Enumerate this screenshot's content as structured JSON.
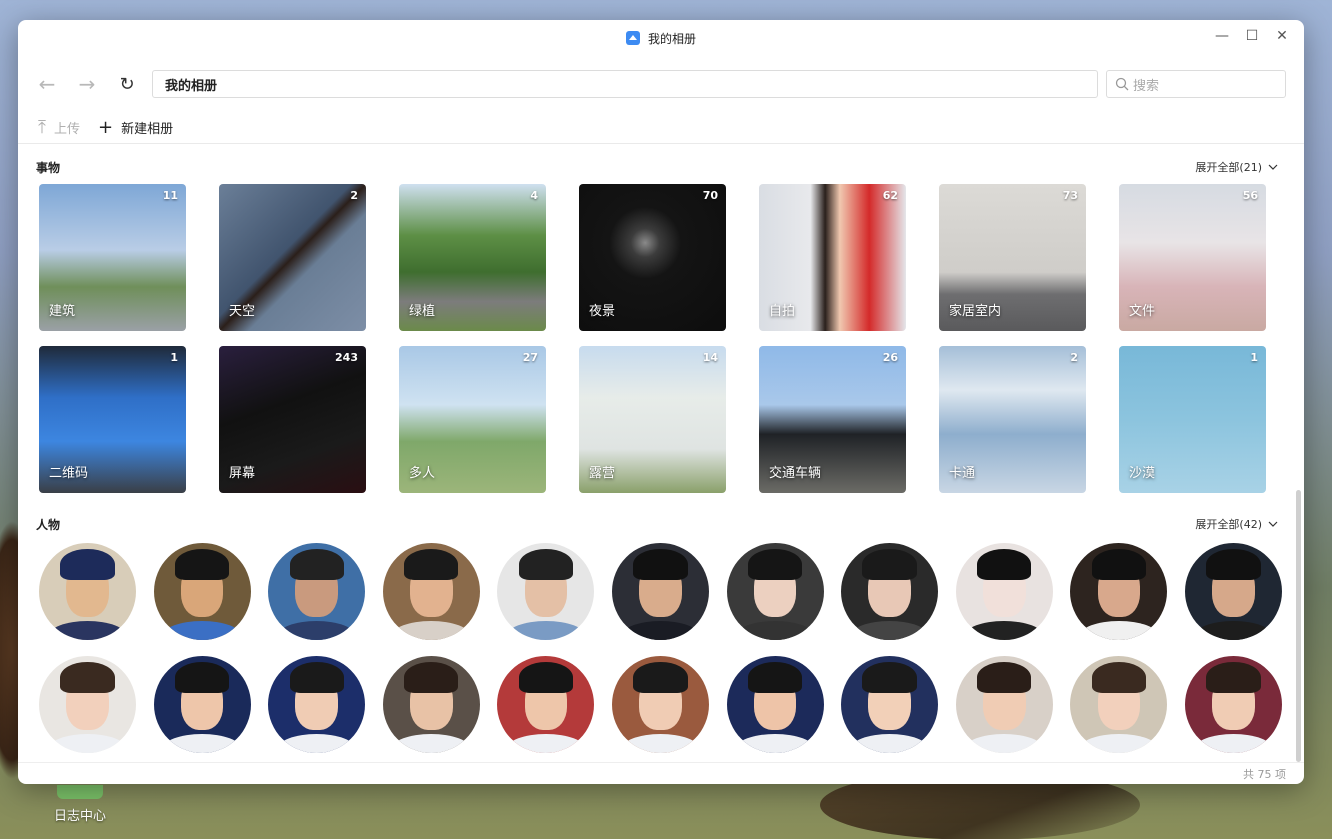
{
  "window": {
    "title": "我的相册"
  },
  "nav": {
    "path": "我的相册",
    "search_placeholder": "搜索"
  },
  "toolbar": {
    "upload_label": "上传",
    "new_album_label": "新建相册"
  },
  "things": {
    "title": "事物",
    "expand_label": "展开全部(21)",
    "tiles": [
      {
        "name": "建筑",
        "count": "11",
        "bg": "linear-gradient(180deg,#7ea7d6 0%,#b9cde6 45%,#6f8f5a 70%,#9aa0a6 100%)"
      },
      {
        "name": "天空",
        "count": "2",
        "bg": "linear-gradient(135deg,#6b7f98 0%,#41546e 45%,#2b1f1a 50%,#6a7e96 60%,#7d8ea6 100%)"
      },
      {
        "name": "绿植",
        "count": "4",
        "bg": "linear-gradient(180deg,#cfe0f0 0%,#5d8f45 35%,#3f6e2f 60%,#7c7c7c 80%,#6b8a4a 100%)"
      },
      {
        "name": "夜景",
        "count": "70",
        "bg": "radial-gradient(circle at 45% 40%,#8a8a8a 0%,#3c3c3c 12%,#141414 30%,#0d0d0d 100%)"
      },
      {
        "name": "自拍",
        "count": "62",
        "bg": "linear-gradient(90deg,#d9dde3 0%,#e8e9ec 35%,#2a201c 45%,#f0c8b0 55%,#d42a2a 75%,#e4e6ea 100%)"
      },
      {
        "name": "家居室内",
        "count": "73",
        "bg": "linear-gradient(180deg,#dcdad6 0%,#cfcdc9 60%,#6e6e70 75%,#5a5a5c 100%)"
      },
      {
        "name": "文件",
        "count": "56",
        "bg": "linear-gradient(180deg,#d6dbe2 0%,#e8e4e6 40%,#d8b4b8 70%,#c9a9a2 100%)"
      },
      {
        "name": "二维码",
        "count": "1",
        "bg": "linear-gradient(180deg,#1f2a3a 0%,#2f6fc7 35%,#3d86e0 65%,#3a3f46 100%)"
      },
      {
        "name": "屏幕",
        "count": "243",
        "bg": "linear-gradient(160deg,#2a1f3e 0%,#111 40%,#1a1a1a 70%,#2a0e12 100%)"
      },
      {
        "name": "多人",
        "count": "27",
        "bg": "linear-gradient(180deg,#a9c8e6 0%,#cfe2f1 40%,#7fa86a 65%,#9cb57a 100%)"
      },
      {
        "name": "露营",
        "count": "14",
        "bg": "linear-gradient(180deg,#c7dbee 0%,#e7ece9 35%,#dfe4e2 70%,#8aa06a 100%)"
      },
      {
        "name": "交通车辆",
        "count": "26",
        "bg": "linear-gradient(180deg,#8fb9e8 0%,#a9c8ea 40%,#1f2226 60%,#6b6b66 100%)"
      },
      {
        "name": "卡通",
        "count": "2",
        "bg": "linear-gradient(180deg,#a5bfd8 0%,#dfe8f0 30%,#8eaecd 60%,#c8d6e4 100%)"
      },
      {
        "name": "沙漠",
        "count": "1",
        "bg": "linear-gradient(180deg,#78b8d8 0%,#8cc4de 50%,#a8d2e6 100%)"
      }
    ]
  },
  "people": {
    "title": "人物",
    "expand_label": "展开全部(42)",
    "faces": [
      {
        "bg": "#d8cdb9",
        "hair": "#1d2b5a",
        "skin": "#e2b88f",
        "shirt": "#2a3560"
      },
      {
        "bg": "#6f5a3a",
        "hair": "#151515",
        "skin": "#d9a679",
        "shirt": "#3b6fc4"
      },
      {
        "bg": "#3f6fa6",
        "hair": "#222",
        "skin": "#c99a7e",
        "shirt": "#2c3e6a"
      },
      {
        "bg": "#8a6a4a",
        "hair": "#1a1a1a",
        "skin": "#e2b28f",
        "shirt": "#d8d0c8"
      },
      {
        "bg": "#e6e6e6",
        "hair": "#222",
        "skin": "#e4c0a6",
        "shirt": "#7a9bc4"
      },
      {
        "bg": "#2c2e36",
        "hair": "#111",
        "skin": "#d9ac8c",
        "shirt": "#1a1c24"
      },
      {
        "bg": "#3a3a3a",
        "hair": "#151515",
        "skin": "#ecd0c0",
        "shirt": "#333"
      },
      {
        "bg": "#2a2a2a",
        "hair": "#1a1a1a",
        "skin": "#e8c8b6",
        "shirt": "#444"
      },
      {
        "bg": "#e8e2e0",
        "hair": "#111",
        "skin": "#f1e0da",
        "shirt": "#222"
      },
      {
        "bg": "#2d241f",
        "hair": "#111",
        "skin": "#d8a88c",
        "shirt": "#f0f0f0"
      },
      {
        "bg": "#1f2733",
        "hair": "#111",
        "skin": "#d6a88a",
        "shirt": "#1d1d1d"
      },
      {
        "bg": "#e9e6e2",
        "hair": "#3a2a20",
        "skin": "#f2d0bc",
        "shirt": "#eef0f4"
      },
      {
        "bg": "#1a2a5a",
        "hair": "#151515",
        "skin": "#eec6aa",
        "shirt": "#eef0f4"
      },
      {
        "bg": "#1c2e6a",
        "hair": "#1a1a1a",
        "skin": "#f0ccb4",
        "shirt": "#eef0f4"
      },
      {
        "bg": "#5a5048",
        "hair": "#2a1e18",
        "skin": "#e8c2a6",
        "shirt": "#eef0f4"
      },
      {
        "bg": "#b43a3a",
        "hair": "#151515",
        "skin": "#eec6aa",
        "shirt": "#eef0f4"
      },
      {
        "bg": "#9a5a3e",
        "hair": "#1a1a1a",
        "skin": "#f0ccb4",
        "shirt": "#eef0f4"
      },
      {
        "bg": "#1c2a5a",
        "hair": "#151515",
        "skin": "#eec4a8",
        "shirt": "#eef0f4"
      },
      {
        "bg": "#22305e",
        "hair": "#1a1a1a",
        "skin": "#f2d0b8",
        "shirt": "#eef0f4"
      },
      {
        "bg": "#d8d0c8",
        "hair": "#2a1e18",
        "skin": "#f0ccb4",
        "shirt": "#eef0f4"
      },
      {
        "bg": "#cfc6b6",
        "hair": "#3a2a20",
        "skin": "#f2d0bc",
        "shirt": "#eef0f4"
      },
      {
        "bg": "#7a2a3a",
        "hair": "#2a1e18",
        "skin": "#f0ccb4",
        "shirt": "#eef0f4"
      }
    ]
  },
  "footer": {
    "total_label": "共 75 项"
  },
  "desktop": {
    "icon_label": "日志中心"
  }
}
